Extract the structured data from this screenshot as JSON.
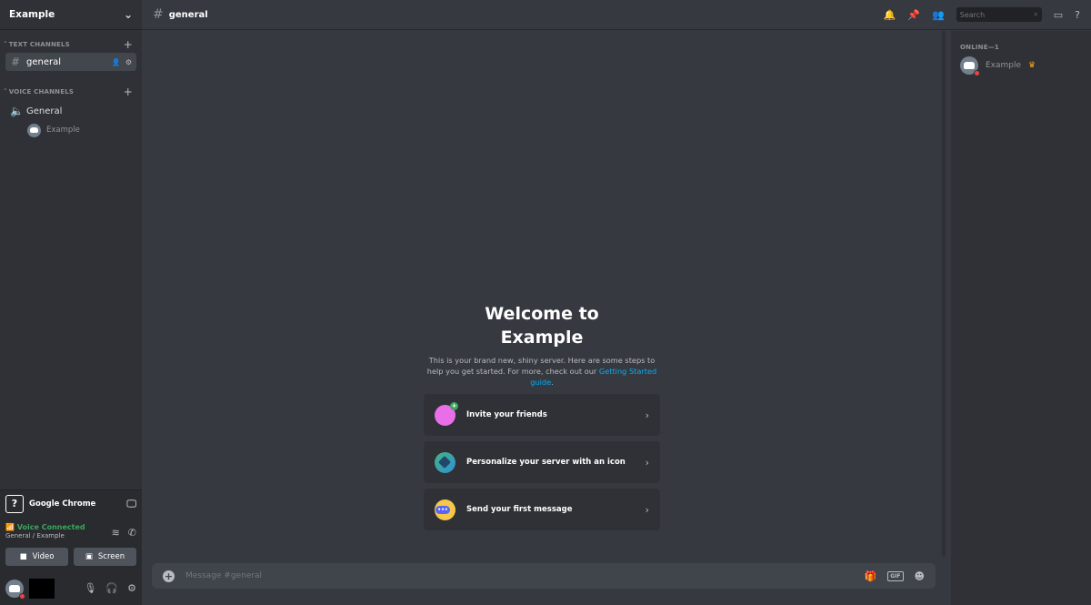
{
  "server": {
    "name": "Example"
  },
  "sidebar": {
    "text_category": "TEXT CHANNELS",
    "text_channels": [
      {
        "name": "general",
        "active": true
      }
    ],
    "voice_category": "VOICE CHANNELS",
    "voice_channels": [
      {
        "name": "General",
        "users": [
          "Example"
        ]
      }
    ]
  },
  "stream": {
    "app": "Google Chrome",
    "icon": "question-mark"
  },
  "voice": {
    "status": "Voice Connected",
    "location": "General / Example",
    "video_label": "Video",
    "screen_label": "Screen"
  },
  "topbar": {
    "channel": "general",
    "search_placeholder": "Search"
  },
  "welcome": {
    "title_line1": "Welcome to",
    "title_line2": "Example",
    "desc": "This is your brand new, shiny server. Here are some steps to help you get started. For more, check out our ",
    "link": "Getting Started guide",
    "desc_end": "."
  },
  "cards": [
    {
      "label": "Invite your friends",
      "icon": "invite-icon"
    },
    {
      "label": "Personalize your server with an icon",
      "icon": "personalize-icon"
    },
    {
      "label": "Send your first message",
      "icon": "message-icon"
    }
  ],
  "chat": {
    "placeholder": "Message #general",
    "gif_label": "GIF"
  },
  "members": {
    "heading": "ONLINE—1",
    "list": [
      {
        "name": "Example",
        "owner": true
      }
    ]
  },
  "colors": {
    "accent_link": "#00aff4",
    "voice_connected": "#3ba55d",
    "dnd": "#ed4245",
    "crown": "#faa61a"
  }
}
